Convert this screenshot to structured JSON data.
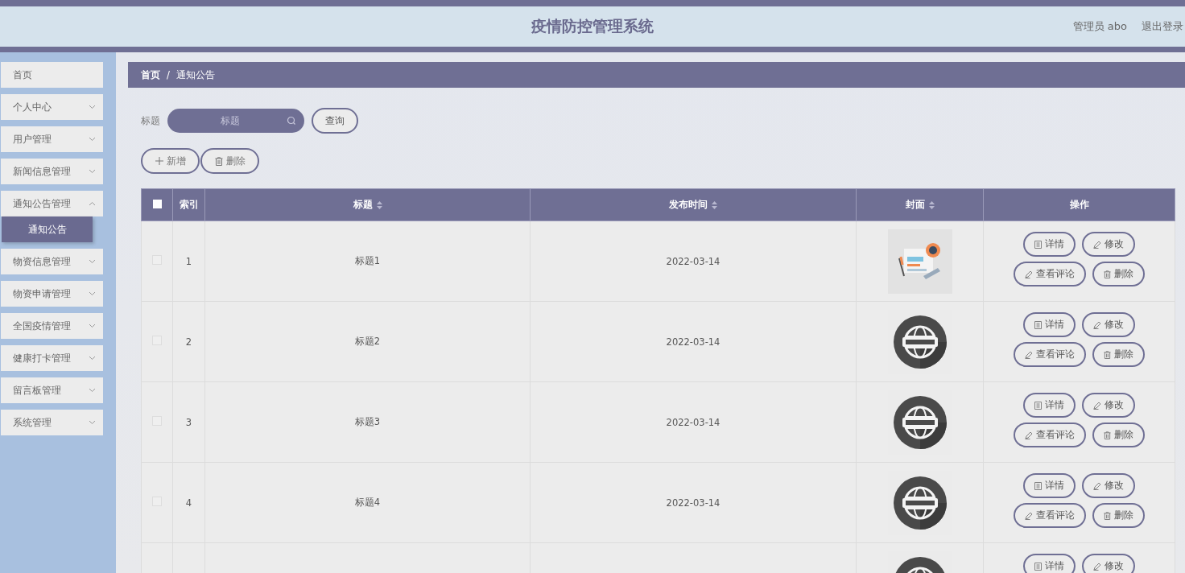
{
  "header": {
    "title": "疫情防控管理系统",
    "user": "管理员 abo",
    "logout": "退出登录"
  },
  "sidebar": {
    "items": [
      {
        "label": "首页",
        "kind": "link",
        "selected": false
      },
      {
        "label": "个人中心",
        "kind": "menu",
        "selected": false,
        "expanded": false
      },
      {
        "label": "用户管理",
        "kind": "menu",
        "selected": false,
        "expanded": false
      },
      {
        "label": "新闻信息管理",
        "kind": "menu",
        "selected": false,
        "expanded": false
      },
      {
        "label": "通知公告管理",
        "kind": "menu",
        "selected": false,
        "expanded": true,
        "children": [
          {
            "label": "通知公告",
            "selected": true
          }
        ]
      },
      {
        "label": "物资信息管理",
        "kind": "menu",
        "selected": false,
        "expanded": false
      },
      {
        "label": "物资申请管理",
        "kind": "menu",
        "selected": false,
        "expanded": false
      },
      {
        "label": "全国疫情管理",
        "kind": "menu",
        "selected": false,
        "expanded": false
      },
      {
        "label": "健康打卡管理",
        "kind": "menu",
        "selected": false,
        "expanded": false
      },
      {
        "label": "留言板管理",
        "kind": "menu",
        "selected": false,
        "expanded": false
      },
      {
        "label": "系统管理",
        "kind": "menu",
        "selected": false,
        "expanded": false
      }
    ]
  },
  "breadcrumb": {
    "separator": "/",
    "items": [
      "首页",
      "通知公告"
    ]
  },
  "search": {
    "label": "标题",
    "placeholder": "标题",
    "button": "查询"
  },
  "toolbar": [
    {
      "label": "新增",
      "kind": "add"
    },
    {
      "label": "删除",
      "kind": "delete"
    }
  ],
  "table": {
    "select_all": {
      "checked": false
    },
    "columns": [
      {
        "label": "索引",
        "sortable": false
      },
      {
        "label": "标题",
        "sortable": true
      },
      {
        "label": "发布时间",
        "sortable": true
      },
      {
        "label": "封面",
        "sortable": true
      },
      {
        "label": "操作",
        "sortable": false
      }
    ],
    "rows": [
      {
        "checked": false,
        "index": "1",
        "title": "标题1",
        "date": "2022-03-14",
        "cover": {
          "kind": "picture"
        },
        "actions": [
          {
            "label": "详情",
            "kind": "detail"
          },
          {
            "label": "修改",
            "kind": "edit"
          },
          {
            "label": "查看评论",
            "kind": "edit"
          },
          {
            "label": "删除",
            "kind": "delete"
          }
        ]
      },
      {
        "checked": false,
        "index": "2",
        "title": "标题2",
        "date": "2022-03-14",
        "cover": {
          "kind": "picture"
        },
        "actions": [
          {
            "label": "详情",
            "kind": "detail"
          },
          {
            "label": "修改",
            "kind": "edit"
          },
          {
            "label": "查看评论",
            "kind": "edit"
          },
          {
            "label": "删除",
            "kind": "delete"
          }
        ]
      },
      {
        "checked": false,
        "index": "3",
        "title": "标题3",
        "date": "2022-03-14",
        "cover": {
          "kind": "picture"
        },
        "actions": [
          {
            "label": "详情",
            "kind": "detail"
          },
          {
            "label": "修改",
            "kind": "edit"
          },
          {
            "label": "查看评论",
            "kind": "edit"
          },
          {
            "label": "删除",
            "kind": "delete"
          }
        ]
      },
      {
        "checked": false,
        "index": "4",
        "title": "标题4",
        "date": "2022-03-14",
        "cover": {
          "kind": "picture"
        },
        "actions": [
          {
            "label": "详情",
            "kind": "detail"
          },
          {
            "label": "修改",
            "kind": "edit"
          },
          {
            "label": "查看评论",
            "kind": "edit"
          },
          {
            "label": "删除",
            "kind": "delete"
          }
        ]
      },
      {
        "cover": {
          "kind": "picture"
        },
        "actions": [
          {
            "label": "详情",
            "kind": "detail"
          },
          {
            "label": "修改",
            "kind": "edit"
          }
        ]
      }
    ]
  }
}
